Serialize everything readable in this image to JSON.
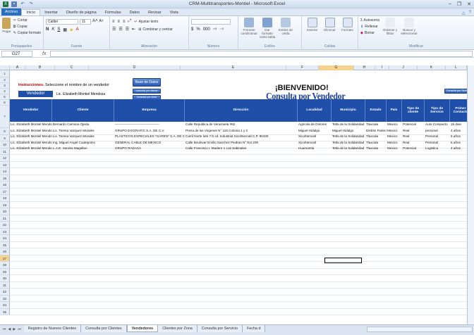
{
  "window": {
    "title": "CRM-Multitransportes-Montiel - Microsoft Excel"
  },
  "menu": {
    "file": "Archivo",
    "tabs": [
      "Inicio",
      "Insertar",
      "Diseño de página",
      "Fórmulas",
      "Datos",
      "Revisar",
      "Vista"
    ]
  },
  "ribbon": {
    "paste": "Pegar",
    "cut": "Cortar",
    "copy": "Copiar",
    "format_painter": "Copiar formato",
    "clipboard": "Portapapeles",
    "font_name": "Calibri",
    "font_size": "11",
    "font_group": "Fuente",
    "wrap": "Ajustar texto",
    "merge": "Combinar y centrar",
    "align_group": "Alineación",
    "number_group": "Número",
    "cond_format": "Formato condicional",
    "table_format": "Dar formato como tabla",
    "cell_styles": "Estilos de celda",
    "styles_group": "Estilos",
    "insert": "Insertar",
    "delete": "Eliminar",
    "format": "Formato",
    "cells_group": "Celdas",
    "autosum": "Σ Autosuma",
    "fill": "Rellenar",
    "clear": "Borrar",
    "sort": "Ordenar y filtrar",
    "find": "Buscar y seleccionar",
    "edit_group": "Modificar"
  },
  "formula": {
    "namebox": "G27",
    "fx": "fx",
    "content": ""
  },
  "columns": [
    "A",
    "B",
    "C",
    "D",
    "E",
    "F",
    "G",
    "H",
    "I",
    "J",
    "K",
    "L"
  ],
  "sheet": {
    "instr_label": "Instrucciones.",
    "instr_text": " Seleccione el nombre de un vendedor",
    "vendedor_label": "Vendedor",
    "vendedor_value": "Lic. Elizabeth Montiel Mendoza",
    "btn_base": "Base de Datos",
    "btn_small1": "consulta por cliente",
    "btn_small2": "consulta por zona",
    "btn_right": "Consulta por Servicio",
    "bienvenido": "¡BIENVENIDO!",
    "consulta": "Consulta por Vendedor"
  },
  "table": {
    "headers": [
      "Vendedor",
      "Cliente",
      "Empresa",
      "Dirección",
      "Localidad",
      "Municipio",
      "Estado",
      "País",
      "Tipo de cliente",
      "Tipo de Servicio",
      "Primer Contacto"
    ],
    "rows": [
      [
        "Lic. Elizabeth Montiel Mendoza",
        "Bernardo Camona Ojeda",
        "-----------------------------------------",
        "Calle Republica de Venezuela #62",
        "Agricola de Dolores",
        "Tetla de la Solidaridad",
        "Tlaxcala",
        "Mexico",
        "Potencial",
        "Auto Compacto",
        "15 dias"
      ],
      [
        "Lic. Elizabeth Montiel Mendoza",
        "Lic. Teresa Vazquez Morales",
        "GRUPO EXIGRAFIC S.A. DE C.V.",
        "Presa de las Virgenes N° 115 Colonia 1 y 2",
        "Miguel Hidalgo",
        "Miguel Hidalgo",
        "Distrito Federal",
        "Mexico",
        "Real",
        "personal",
        "4 años"
      ],
      [
        "Lic. Elizabeth Montiel Mendoza",
        "Lic. Teresa Vazquez Morales",
        "PLASTICOS ESPECIALES *GAREN* S.A. DE C.V.",
        "Carril Norte lote 7-b cd. Industrial Xicohtencatl C.P. 90430",
        "Xicohtencatl",
        "Tetla de la Solidaridad",
        "Tlaxcala",
        "Mexico",
        "Real",
        "Personal",
        "6 años"
      ],
      [
        "Lic. Elizabeth Montiel Mendoza",
        "Ing. Miguel Angel Cuatepotzo",
        "GENERAL CABLE DE MEXICO",
        "Calle Boulevar Emilio Sanchez Piedras N° Ext 209",
        "Xicohtencatl",
        "Tetla de la Solidaridad",
        "Tlaxcala",
        "Mexico",
        "Real",
        "Personal",
        "5 años"
      ],
      [
        "Lic. Elizabeth Montiel Mendoza",
        "L.A.E. Sandra Magallan",
        "GRUPO RADASA",
        "Calle Francisco I. Madero 1 Los Sabinales",
        "Huamantla",
        "Tetla de la Solidaridad",
        "Tlaxcala",
        "Mexico",
        "Potencial",
        "Logistica",
        "4 años"
      ]
    ]
  },
  "sheet_tabs": [
    "Registro de Nuevos Clientes",
    "Consulta por Clientes",
    "Vendedores",
    "Clientes por Zona",
    "Consulta por Servicio",
    "Fecha d"
  ],
  "active_tab": "Vendedores",
  "colors": {
    "accent": "#1f4fa8",
    "title": "#1f3f9b",
    "instr": "#c00000"
  }
}
